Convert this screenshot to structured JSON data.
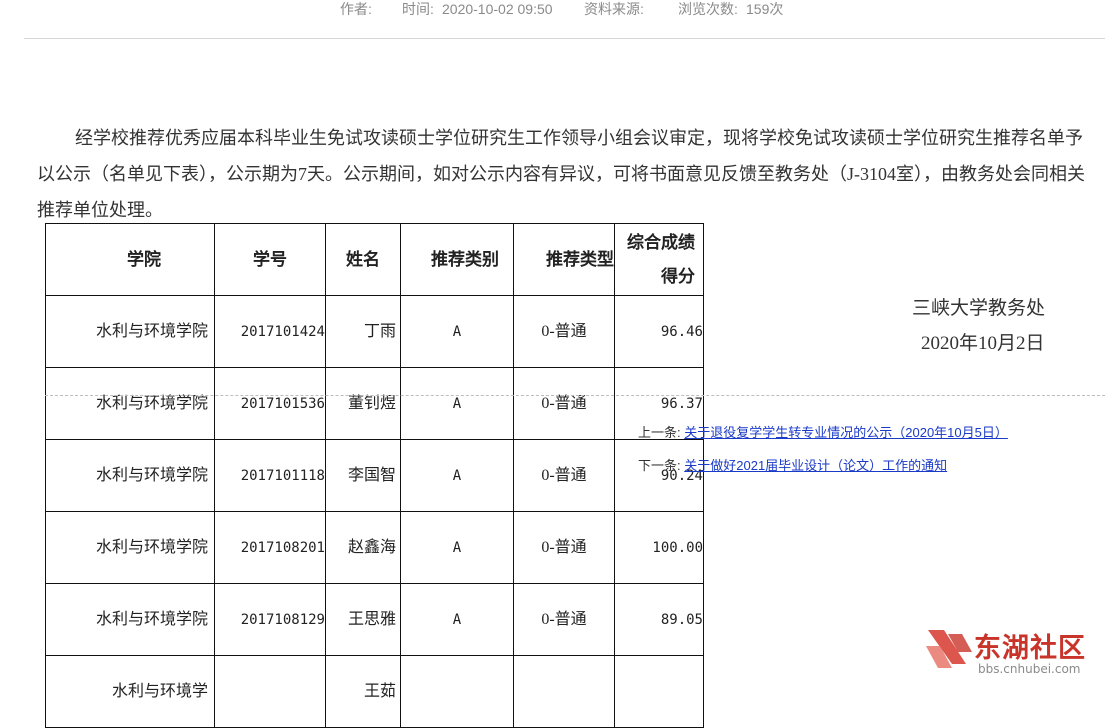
{
  "meta": {
    "author_label": "作者:",
    "time_label": "时间:",
    "time_value": "2020-10-02 09:50",
    "source_label": "资料来源:",
    "views_label": "浏览次数:",
    "views_value": "159次"
  },
  "article": {
    "paragraph": "经学校推荐优秀应届本科毕业生免试攻读硕士学位研究生工作领导小组会议审定，现将学校免试攻读硕士学位研究生推荐名单予以公示（名单见下表），公示期为7天。公示期间，如对公示内容有异议，可将书面意见反馈至教务处（J-3104室），由教务处会同相关推荐单位处理。"
  },
  "table": {
    "headers": {
      "college": "学院",
      "student_id": "学号",
      "name": "姓名",
      "category": "推荐类别",
      "type": "推荐类型",
      "score": "综合成绩得分"
    },
    "rows": [
      {
        "college": "水利与环境学院",
        "student_id": "2017101424",
        "name": "丁雨",
        "category": "A",
        "type": "0-普通",
        "score": "96.46"
      },
      {
        "college": "水利与环境学院",
        "student_id": "2017101536",
        "name": "董钊煜",
        "category": "A",
        "type": "0-普通",
        "score": "96.37"
      },
      {
        "college": "水利与环境学院",
        "student_id": "2017101118",
        "name": "李国智",
        "category": "A",
        "type": "0-普通",
        "score": "90.24"
      },
      {
        "college": "水利与环境学院",
        "student_id": "2017108201",
        "name": "赵鑫海",
        "category": "A",
        "type": "0-普通",
        "score": "100.00"
      },
      {
        "college": "水利与环境学院",
        "student_id": "2017108129",
        "name": "王思雅",
        "category": "A",
        "type": "0-普通",
        "score": "89.05"
      },
      {
        "college": "水利与环境学",
        "student_id": "",
        "name": "王茹",
        "category": "",
        "type": "",
        "score": ""
      }
    ]
  },
  "signature": {
    "org": "三峡大学教务处",
    "date": "2020年10月2日"
  },
  "navigation": {
    "prev_label": "上一条:",
    "prev_title": "关于退役复学学生转专业情况的公示（2020年10月5日）",
    "next_label": "下一条:",
    "next_title": "关于做好2021届毕业设计（论文）工作的通知"
  },
  "watermark": {
    "name": "东湖社区",
    "url": "bbs.cnhubei.com"
  },
  "colors": {
    "link": "#1a3ac8",
    "watermark_red": "#c9342a"
  }
}
